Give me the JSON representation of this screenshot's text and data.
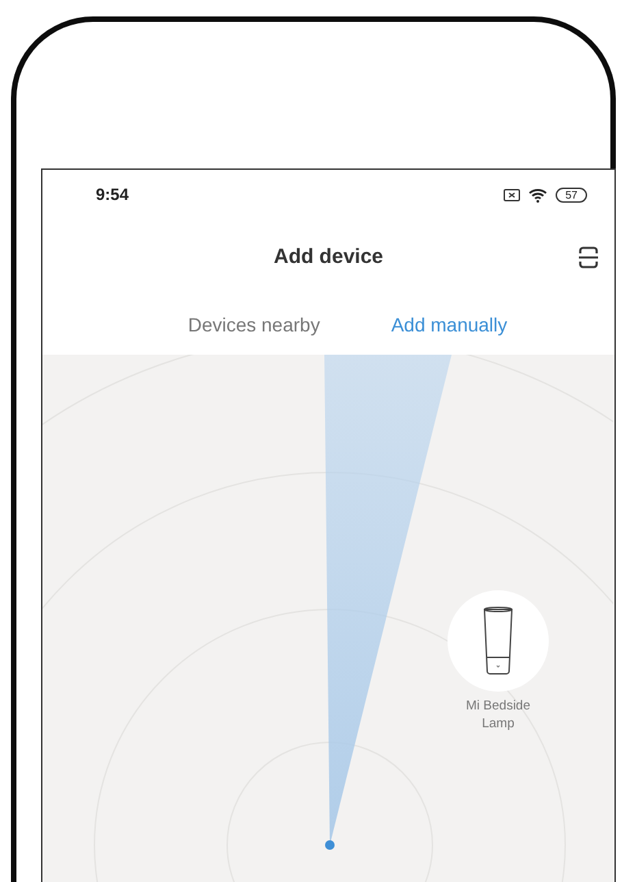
{
  "status_bar": {
    "time": "9:54",
    "battery": "57"
  },
  "header": {
    "title": "Add device"
  },
  "tabs": [
    {
      "label": "Devices nearby",
      "selected": false
    },
    {
      "label": "Add manually",
      "selected": true
    }
  ],
  "devices": [
    {
      "name": "Mi Bedside Lamp"
    }
  ]
}
